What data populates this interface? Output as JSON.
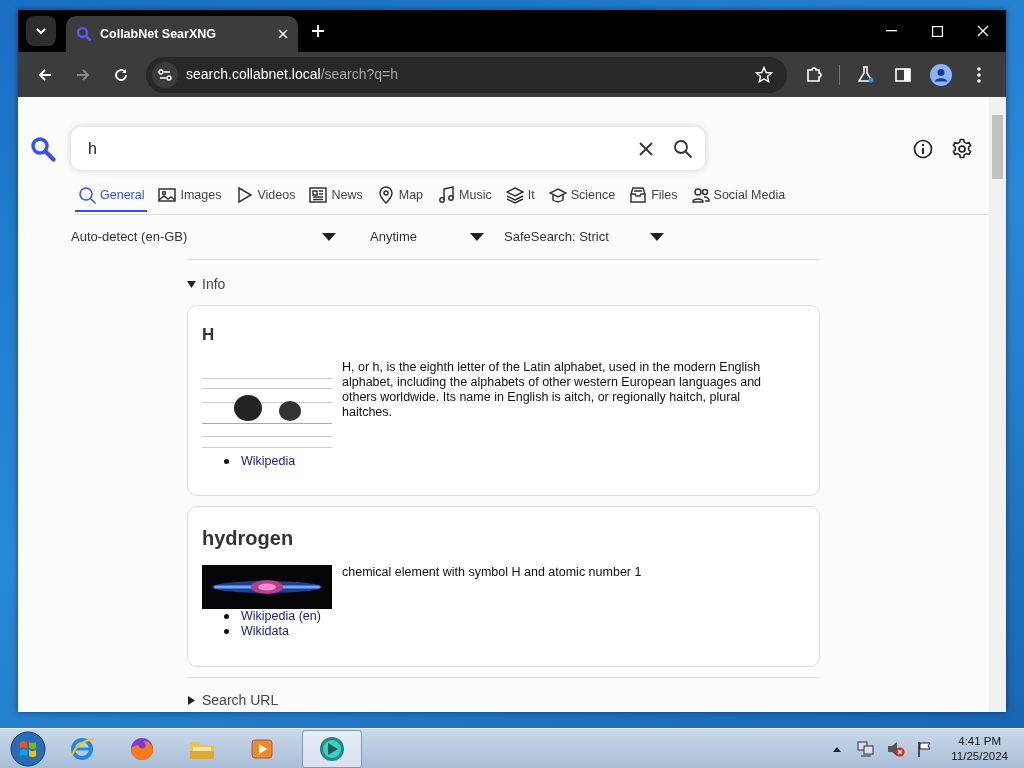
{
  "browser": {
    "tab_title": "CollabNet SearXNG",
    "url_host": "search.collabnet.local",
    "url_path": "/search?q=h"
  },
  "search": {
    "value": "h"
  },
  "categories": [
    {
      "label": "General",
      "selected": true
    },
    {
      "label": "Images",
      "selected": false
    },
    {
      "label": "Videos",
      "selected": false
    },
    {
      "label": "News",
      "selected": false
    },
    {
      "label": "Map",
      "selected": false
    },
    {
      "label": "Music",
      "selected": false
    },
    {
      "label": "It",
      "selected": false
    },
    {
      "label": "Science",
      "selected": false
    },
    {
      "label": "Files",
      "selected": false
    },
    {
      "label": "Social Media",
      "selected": false
    }
  ],
  "filters": [
    "Auto-detect (en-GB)",
    "Anytime",
    "SafeSearch: Strict"
  ],
  "info": {
    "label": "Info",
    "expanded": true
  },
  "infoboxes": [
    {
      "title": "H",
      "description": "H, or h, is the eighth letter of the Latin alphabet, used in the modern English alphabet, including the alphabets of other western European languages and others worldwide. Its name in English is aitch, or regionally haitch, plural haitches.",
      "links": [
        "Wikipedia"
      ]
    },
    {
      "title": "hydrogen",
      "description": "chemical element with symbol H and atomic number 1",
      "links": [
        "Wikipedia (en)",
        "Wikidata"
      ]
    }
  ],
  "search_url": {
    "label": "Search URL",
    "expanded": false
  },
  "taskbar": {
    "apps": [
      {
        "selected": false
      },
      {
        "selected": false
      },
      {
        "selected": false
      },
      {
        "selected": false
      },
      {
        "selected": true
      }
    ],
    "time": "4:41 PM",
    "date": "11/25/2024"
  }
}
